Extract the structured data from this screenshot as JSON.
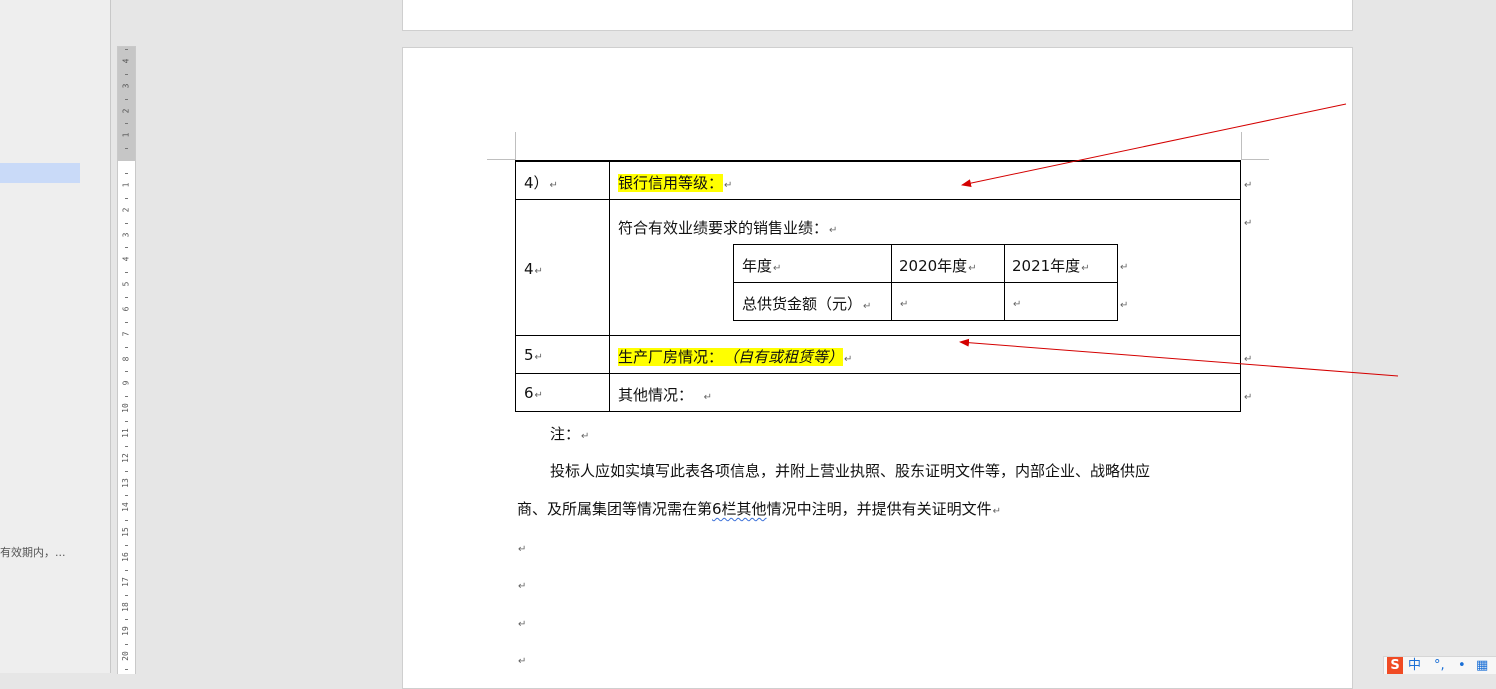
{
  "navigation": {
    "snippet": "有效期内，..."
  },
  "ruler": {
    "upper_ticks": [
      "4",
      "3",
      "2",
      "1"
    ],
    "lower_ticks": [
      "1",
      "2",
      "3",
      "4",
      "5",
      "6",
      "7",
      "8",
      "9",
      "10",
      "11",
      "12",
      "13",
      "14",
      "15",
      "16",
      "17",
      "18",
      "19",
      "20"
    ]
  },
  "document": {
    "main_table": {
      "rows": [
        {
          "no": "4）",
          "content": "银行信用等级："
        },
        {
          "no": "4",
          "content": "符合有效业绩要求的销售业绩："
        },
        {
          "no": "5",
          "content_label": "生产厂房情况：",
          "content_note": "（自有或租赁等）"
        },
        {
          "no": "6",
          "content": "其他情况："
        }
      ]
    },
    "inner_table": {
      "headers": [
        "年度",
        "2020年度",
        "2021年度"
      ],
      "row_label": "总供货金额（元）"
    },
    "note_label": "注：",
    "note_line1": "投标人应如实填写此表各项信息，并附上营业执照、股东证明文件等，内部企业、战略供应",
    "note_line2_a": "商、及所属集团等情况需在第",
    "note_line2_b": "6栏其他",
    "note_line2_c": "情况中注明，并提供有关证明文件",
    "paragraph_mark": "↵"
  },
  "ime_toolbar": {
    "logo": "S",
    "mode": "中",
    "punct": "°,",
    "extra": "•",
    "grid": "▦"
  },
  "colors": {
    "highlight": "#ffff00",
    "annotation_arrow": "#d40000",
    "ime_logo": "#f04b24",
    "ime_mode": "#1a6fd6"
  }
}
